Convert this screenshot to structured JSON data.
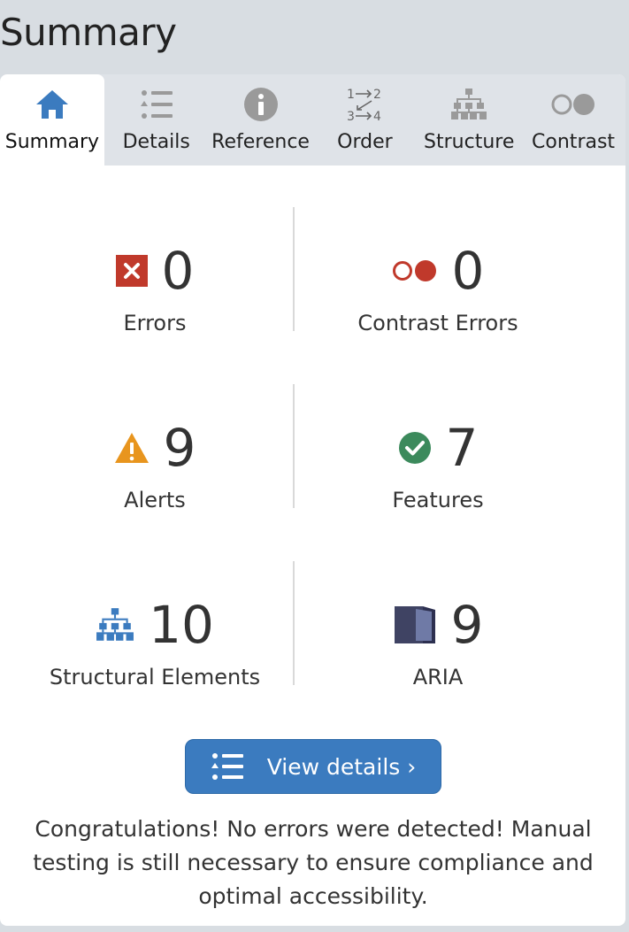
{
  "page": {
    "title": "Summary"
  },
  "tabs": [
    {
      "label": "Summary",
      "icon": "home-icon",
      "active": true
    },
    {
      "label": "Details",
      "icon": "list-icon"
    },
    {
      "label": "Reference",
      "icon": "info-icon"
    },
    {
      "label": "Order",
      "icon": "order-icon",
      "icon_text": [
        "1",
        "2",
        "3",
        "4"
      ]
    },
    {
      "label": "Structure",
      "icon": "structure-icon"
    },
    {
      "label": "Contrast",
      "icon": "contrast-icon"
    }
  ],
  "metrics": {
    "errors": {
      "value": "0",
      "label": "Errors",
      "icon": "error-icon"
    },
    "contrast_errors": {
      "value": "0",
      "label": "Contrast Errors",
      "icon": "contrast-error-icon"
    },
    "alerts": {
      "value": "9",
      "label": "Alerts",
      "icon": "alert-icon"
    },
    "features": {
      "value": "7",
      "label": "Features",
      "icon": "feature-check-icon"
    },
    "structural": {
      "value": "10",
      "label": "Structural Elements",
      "icon": "structure-icon"
    },
    "aria": {
      "value": "9",
      "label": "ARIA",
      "icon": "aria-icon"
    }
  },
  "actions": {
    "view_details_label": "View details ›"
  },
  "message": "Congratulations! No errors were detected! Manual testing is still necessary to ensure compliance and optimal accessibility.",
  "colors": {
    "accent": "#3b7bbf",
    "error": "#c0392b",
    "alert": "#e8951e",
    "feature": "#3c8a5c",
    "structure": "#3b7bbf",
    "aria": "#3f4363",
    "tab_icon": "#9a9a9a"
  }
}
